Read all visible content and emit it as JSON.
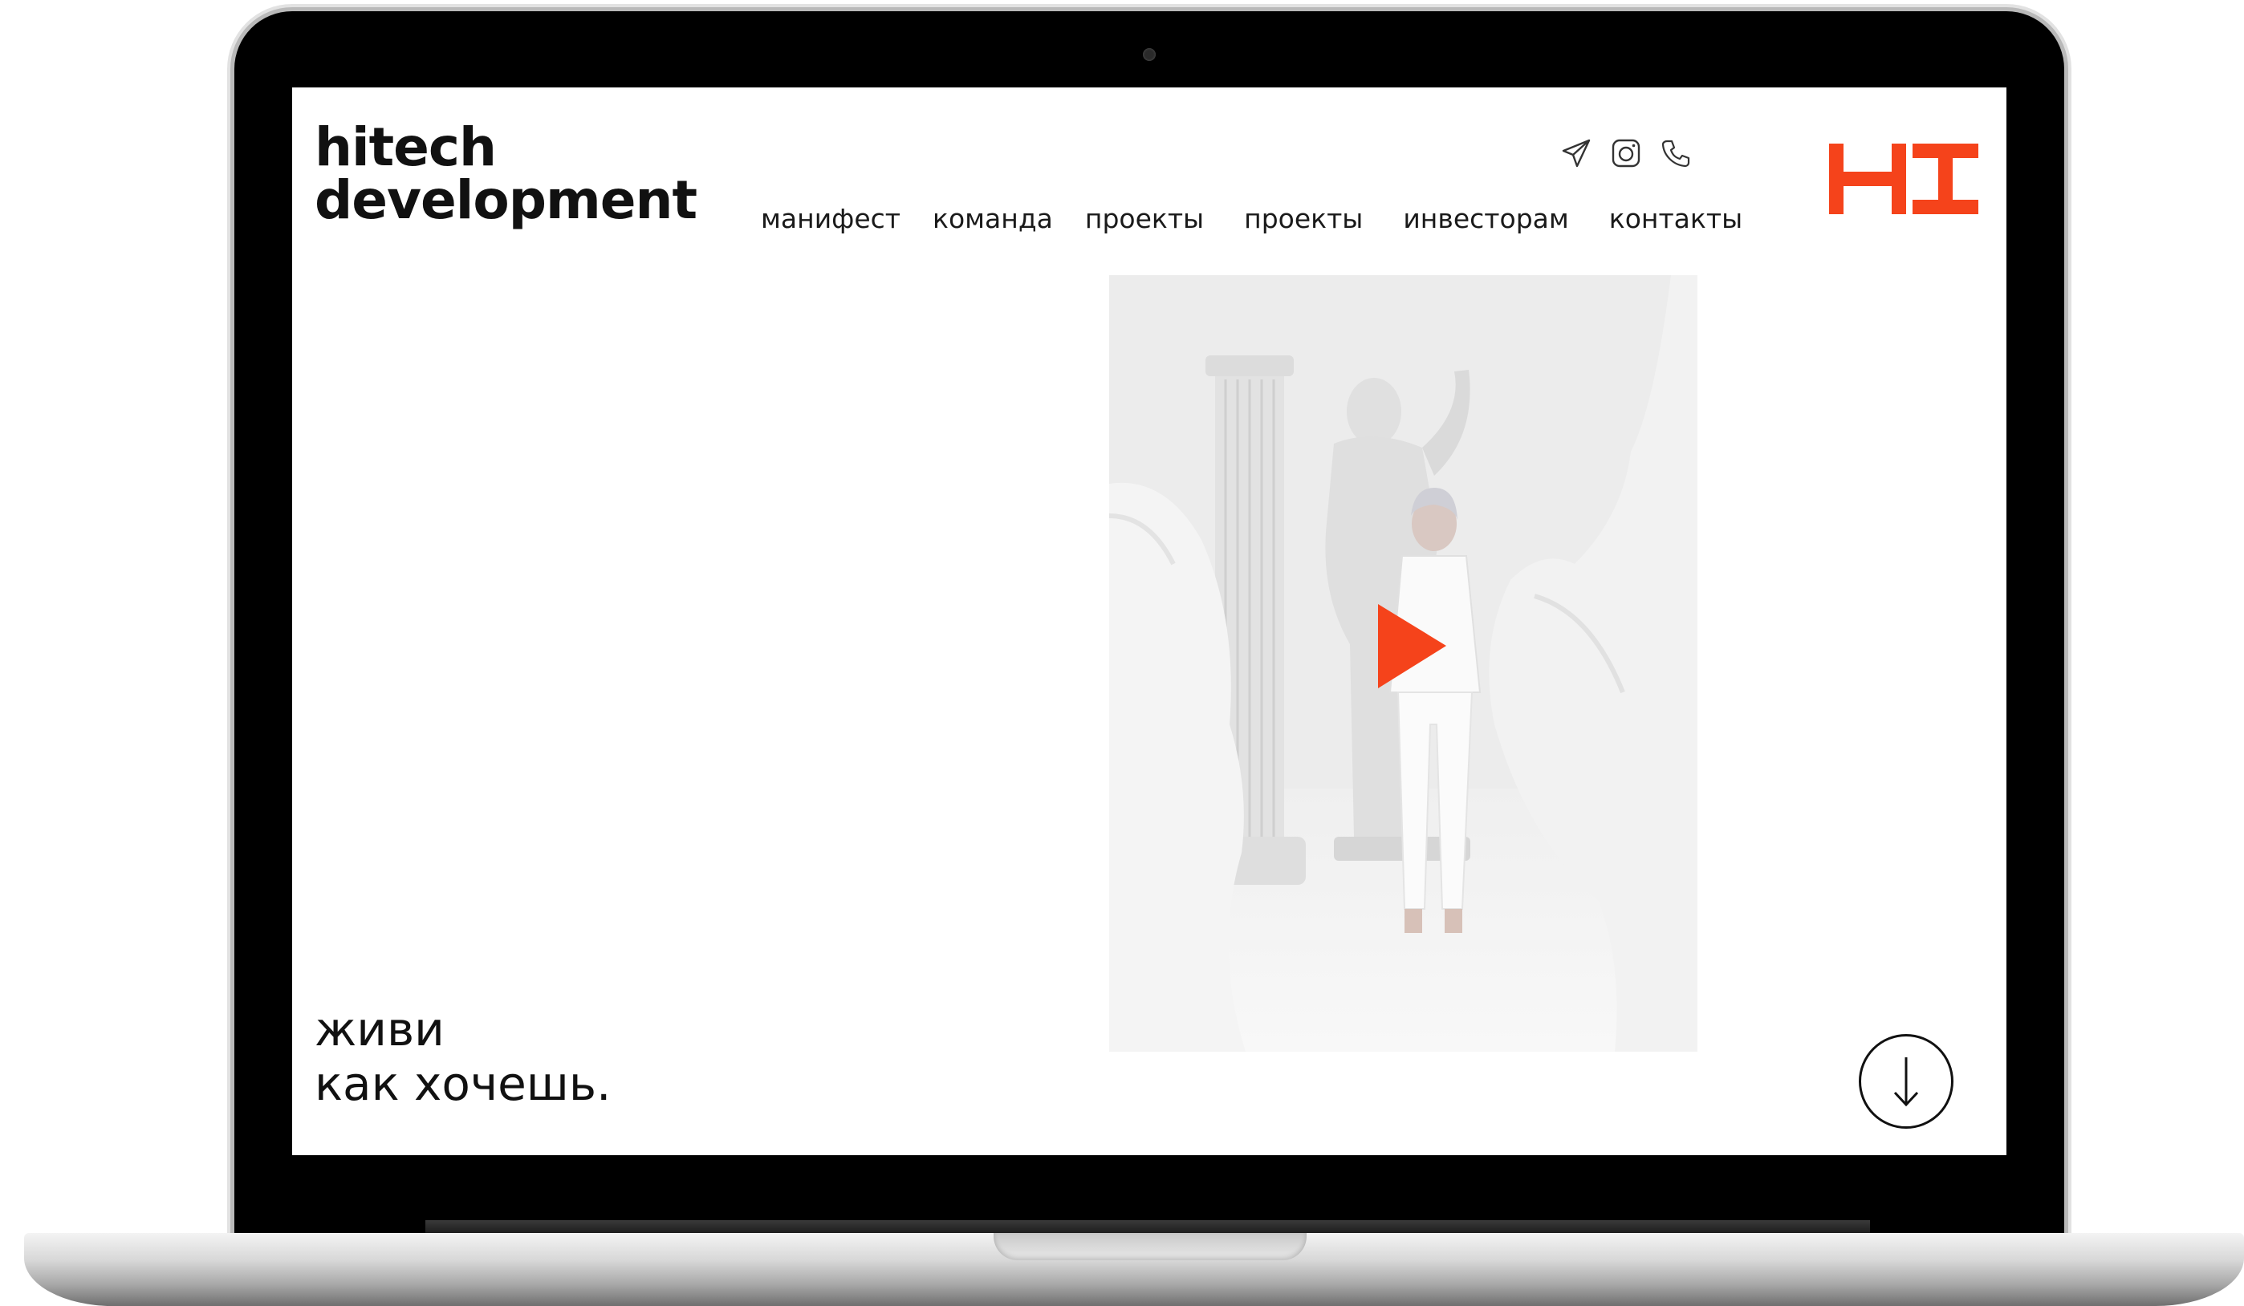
{
  "site": {
    "logo_line1": "hitech",
    "logo_line2": "development",
    "brand_mark_text": "HI",
    "accent_color": "#f5431b"
  },
  "nav": {
    "items": [
      {
        "label": "манифест"
      },
      {
        "label": "команда"
      },
      {
        "label": "проекты"
      },
      {
        "label": "проекты"
      },
      {
        "label": "инвесторам"
      },
      {
        "label": "контакты"
      }
    ]
  },
  "social": {
    "icons": [
      "telegram-icon",
      "instagram-icon",
      "phone-icon"
    ]
  },
  "hero": {
    "tagline_line1": "живи",
    "tagline_line2": "как хочешь.",
    "play_icon": "play-icon",
    "scroll_icon": "arrow-down-icon"
  }
}
